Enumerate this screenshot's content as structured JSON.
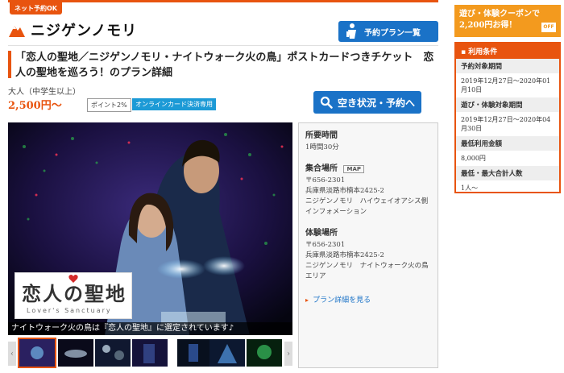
{
  "net_badge": "ネット予約OK",
  "brand": {
    "name": "ニジゲンノモリ"
  },
  "plan_list_button": "予約プラン一覧",
  "title": "「恋人の聖地／ニジゲンノモリ・ナイトウォーク火の鳥」ポストカードつきチケット　恋人の聖地を巡ろう！のプラン詳細",
  "age_label": "大人（中学生以上）",
  "price": "2,500円〜",
  "badges": {
    "point": "ポイント2%",
    "online": "オンラインカード決済専用"
  },
  "availability_button": "空き状況・予約へ",
  "photo": {
    "logo_kanji": "恋人の聖地",
    "logo_roman": "Lover's Sanctuary",
    "caption": "ナイトウォーク火の鳥は『恋人の聖地』に選定されています♪"
  },
  "thumbnails": {
    "prev": "‹",
    "next": "›",
    "count": 8,
    "active_index": 0
  },
  "info": {
    "duration_label": "所要時間",
    "duration_value": "1時間30分",
    "meeting_label": "集合場所",
    "map_badge": "MAP",
    "meeting_postal": "〒656-2301",
    "meeting_address": "兵庫県淡路市楠本2425-2",
    "meeting_place": "ニジゲンノモリ　ハイウェイオアシス側インフォメーション",
    "experience_label": "体験場所",
    "experience_postal": "〒656-2301",
    "experience_address": "兵庫県淡路市楠本2425-2",
    "experience_place": "ニジゲンノモリ　ナイトウォーク火の鳥エリア",
    "detail_link": "プラン詳細を見る"
  },
  "coupon": {
    "text": "遊び・体験クーポンで2,200円お得！",
    "off": "OFF"
  },
  "terms": {
    "heading": "利用条件",
    "rows": [
      {
        "title": "予約対象期間",
        "value": "2019年12月27日〜2020年01月10日"
      },
      {
        "title": "遊び・体験対象期間",
        "value": "2019年12月27日〜2020年04月30日"
      },
      {
        "title": "最低利用金額",
        "value": "8,000円"
      },
      {
        "title": "最低・最大合計人数",
        "value": "1人〜"
      }
    ]
  },
  "colors": {
    "accent": "#e8540f",
    "primary_blue": "#1a72c7",
    "coupon_orange": "#f39a1e"
  }
}
